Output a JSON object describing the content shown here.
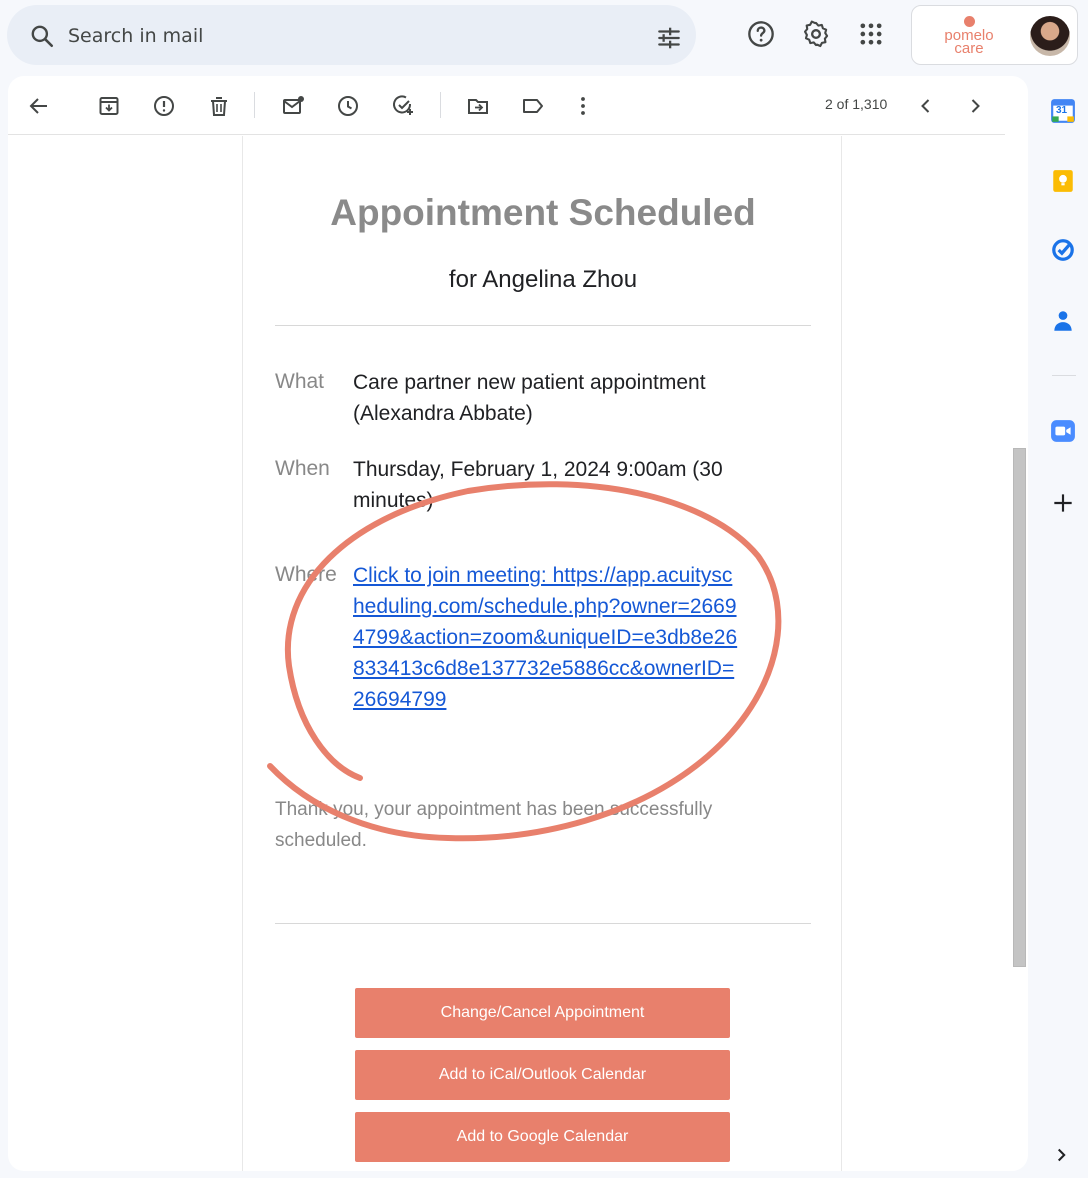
{
  "search": {
    "placeholder": "Search in mail"
  },
  "brand": {
    "logo_line1": "pomelo",
    "logo_line2": "care"
  },
  "toolbar": {
    "pager": "2 of 1,310"
  },
  "email": {
    "title": "Appointment Scheduled",
    "subtitle": "for Angelina Zhou",
    "what_label": "What",
    "what_value": "Care partner new patient appointment (Alexandra Abbate)",
    "when_label": "When",
    "when_value": "Thursday, February 1, 2024 9:00am (30 minutes)",
    "where_label": "Where",
    "where_link": "Click to join meeting: https://app.acuityscheduling.com/schedule.php?owner=26694799&action=zoom&uniqueID=e3db8e26833413c6d8e137732e5886cc&ownerID=26694799",
    "thanks": "Thank you, your appointment has been successfully scheduled.",
    "buttons": {
      "change": "Change/Cancel Appointment",
      "ical": "Add to iCal/Outlook Calendar",
      "google": "Add to Google Calendar"
    }
  },
  "side": {
    "calendar_day": "31"
  },
  "colors": {
    "accent": "#e8806c",
    "link": "#1558d6",
    "annotation": "#e8806c"
  }
}
